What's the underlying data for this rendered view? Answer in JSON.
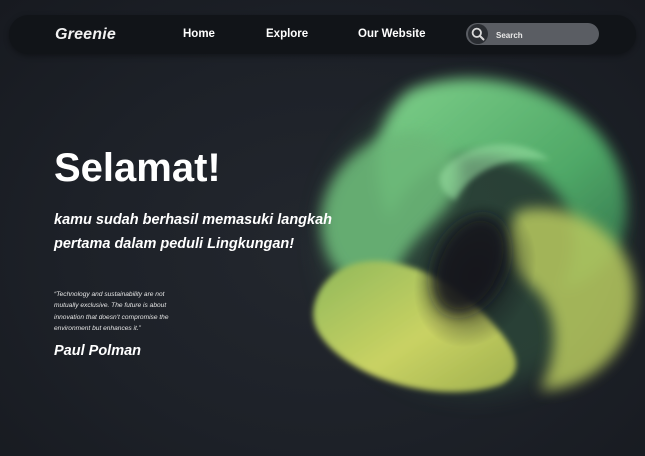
{
  "navbar": {
    "brand": "Greenie",
    "links": [
      "Home",
      "Explore",
      "Our Website"
    ],
    "search": {
      "placeholder": "Search",
      "value": ""
    }
  },
  "hero": {
    "title": "Selamat!",
    "subtitle_lines": [
      "kamu sudah berhasil memasuki langkah",
      "pertama dalam peduli Lingkungan!"
    ],
    "quote_lines": [
      "“Technology and sustainability are not",
      "mutually exclusive. The future is about",
      "innovation that doesn't compromise the",
      "environment but enhances it.”"
    ],
    "author": "Paul Polman"
  },
  "colors": {
    "background": "#1d2128",
    "navbar": "#111418",
    "search_box": "#5a5d63",
    "accent_green": "#5fb870",
    "accent_lime": "#c7d260"
  },
  "icons": {
    "search": "search-icon",
    "decoration": "abstract-swirl"
  }
}
